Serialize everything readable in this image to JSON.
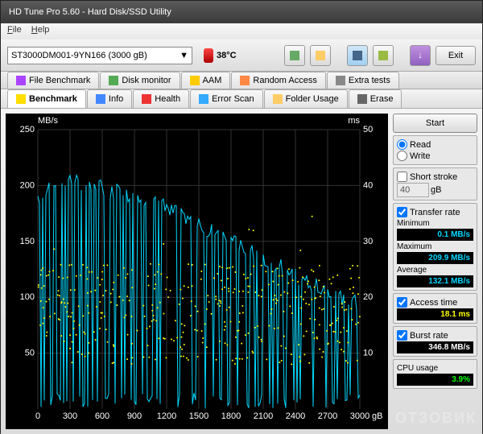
{
  "window": {
    "title": "HD Tune Pro 5.60 - Hard Disk/SSD Utility"
  },
  "menu": {
    "file": "File",
    "help": "Help"
  },
  "toolbar": {
    "drive": "ST3000DM001-9YN166 (3000 gB)",
    "temp": "38°C",
    "exit": "Exit"
  },
  "tabs_row1": [
    "File Benchmark",
    "Disk monitor",
    "AAM",
    "Random Access",
    "Extra tests"
  ],
  "tabs_row2": [
    "Benchmark",
    "Info",
    "Health",
    "Error Scan",
    "Folder Usage",
    "Erase"
  ],
  "panel": {
    "start": "Start",
    "read": "Read",
    "write": "Write",
    "short_stroke": "Short stroke",
    "stroke_val": "40",
    "stroke_unit": "gB",
    "transfer_rate": "Transfer rate",
    "minimum": "Minimum",
    "min_val": "0.1 MB/s",
    "maximum": "Maximum",
    "max_val": "209.9 MB/s",
    "average": "Average",
    "avg_val": "132.1 MB/s",
    "access_time": "Access time",
    "access_val": "18.1 ms",
    "burst_rate": "Burst rate",
    "burst_val": "346.8 MB/s",
    "cpu_usage": "CPU usage",
    "cpu_val": "3.9%"
  },
  "chart_data": {
    "type": "line",
    "title": "",
    "xlabel": "gB",
    "ylabel_left": "MB/s",
    "ylabel_right": "ms",
    "xlim": [
      0,
      3000
    ],
    "ylim_left": [
      0,
      250
    ],
    "ylim_right": [
      0,
      50
    ],
    "x_ticks": [
      0,
      300,
      600,
      900,
      1200,
      1500,
      1800,
      2100,
      2400,
      2700,
      3000
    ],
    "y_ticks_left": [
      50,
      100,
      150,
      200,
      250
    ],
    "y_ticks_right": [
      10,
      20,
      30,
      40,
      50
    ],
    "series": [
      {
        "name": "Transfer rate",
        "color": "#00d8ff",
        "axis": "left",
        "note": "Highly oscillating transfer rate with frequent drops to near 0; envelope declines from ~200 MB/s at start to ~100 MB/s at end",
        "envelope_high": [
          {
            "x": 0,
            "y": 185
          },
          {
            "x": 200,
            "y": 205
          },
          {
            "x": 500,
            "y": 200
          },
          {
            "x": 900,
            "y": 190
          },
          {
            "x": 1200,
            "y": 180
          },
          {
            "x": 1500,
            "y": 165
          },
          {
            "x": 1800,
            "y": 150
          },
          {
            "x": 2100,
            "y": 135
          },
          {
            "x": 2400,
            "y": 120
          },
          {
            "x": 2700,
            "y": 105
          },
          {
            "x": 3000,
            "y": 95
          }
        ],
        "envelope_low": 0.1
      },
      {
        "name": "Access time",
        "color": "#ffff00",
        "axis": "right",
        "type": "scatter",
        "note": "Scatter cloud of access times mostly between 8-25 ms spanning full x range",
        "mean": 18.1,
        "range": [
          5,
          35
        ]
      }
    ]
  },
  "watermark": "ОТЗОВИК"
}
